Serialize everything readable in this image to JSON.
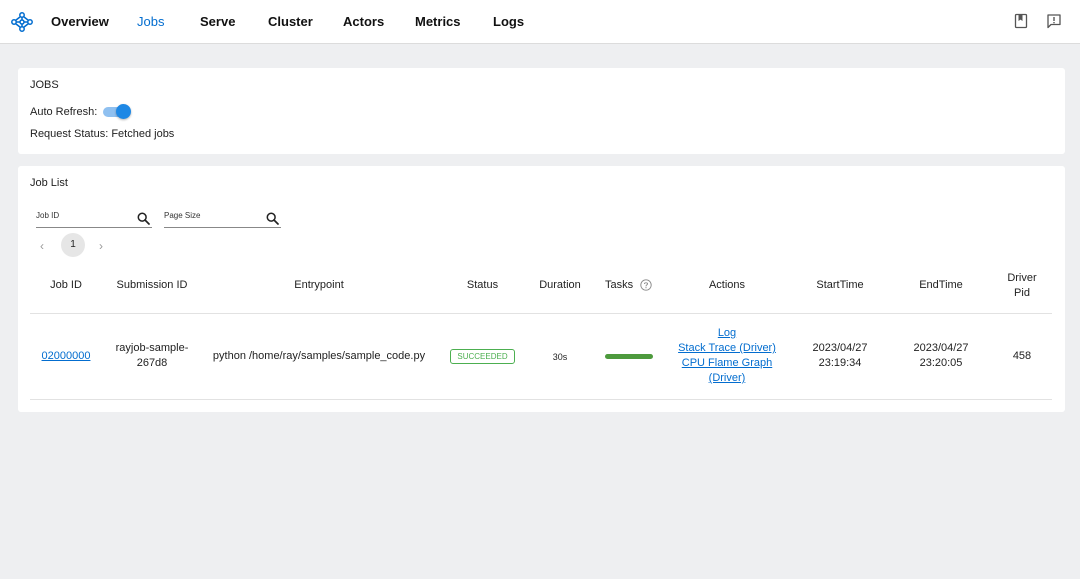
{
  "nav": {
    "items": [
      {
        "label": "Overview"
      },
      {
        "label": "Jobs"
      },
      {
        "label": "Serve"
      },
      {
        "label": "Cluster"
      },
      {
        "label": "Actors"
      },
      {
        "label": "Metrics"
      },
      {
        "label": "Logs"
      }
    ],
    "active": "Jobs",
    "icons": [
      "ray-logo-icon",
      "docs-book-icon",
      "feedback-icon"
    ]
  },
  "jobs_card": {
    "title": "JOBS",
    "auto_refresh_label": "Auto Refresh:",
    "auto_refresh_on": true,
    "request_status": "Request Status: Fetched jobs"
  },
  "job_list": {
    "title": "Job List",
    "search_job_id_placeholder": "Job ID",
    "search_page_size_placeholder": "Page Size",
    "pager": {
      "prev": "‹",
      "page": "1",
      "next": "›"
    },
    "columns": {
      "job_id": "Job ID",
      "submission_id": "Submission ID",
      "entrypoint": "Entrypoint",
      "status": "Status",
      "duration": "Duration",
      "tasks": "Tasks",
      "actions": "Actions",
      "start_time": "StartTime",
      "end_time": "EndTime",
      "driver_pid_1": "Driver",
      "driver_pid_2": "Pid"
    },
    "rows": [
      {
        "job_id": "02000000",
        "submission_id_1": "rayjob-sample-",
        "submission_id_2": "267d8",
        "entrypoint": "python /home/ray/samples/sample_code.py",
        "status": "SUCCEEDED",
        "duration": "30s",
        "tasks_progress": 1.0,
        "actions": {
          "log": "Log",
          "stack_trace": "Stack Trace (Driver)",
          "flame_1": "CPU Flame Graph",
          "flame_2": "(Driver)"
        },
        "start_date": "2023/04/27",
        "start_clock": "23:19:34",
        "end_date": "2023/04/27",
        "end_clock": "23:20:05",
        "driver_pid": "458"
      }
    ]
  },
  "colors": {
    "accent": "#036dcf",
    "success": "#4caf50",
    "task_bar": "#4d9a3d",
    "background": "#eeeff1"
  }
}
